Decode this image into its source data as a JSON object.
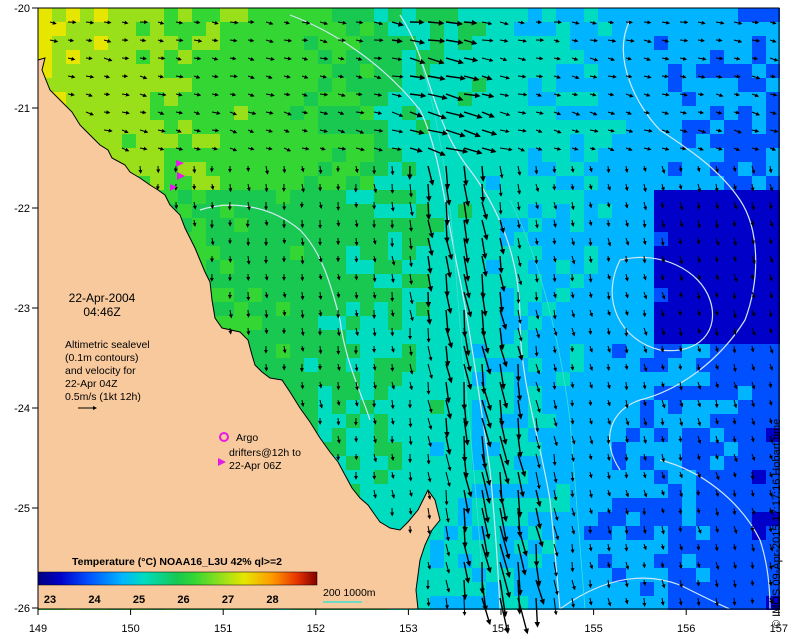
{
  "map": {
    "date": "22-Apr-2004",
    "time": "04:46Z",
    "altimetry_note": [
      "Altimetric sealevel",
      "(0.1m contours)",
      "and velocity for",
      "22-Apr 04Z",
      "0.5m/s (1kt 12h)"
    ],
    "argo_label": "Argo",
    "drifter_label": [
      "drifters@12h to",
      "22-Apr 06Z"
    ],
    "colorbar_title": "Temperature (°C) NOAA16_L3U 42% ql>=2",
    "colorbar_ticks": [
      "23",
      "24",
      "25",
      "26",
      "27",
      "28"
    ],
    "depth_legend": "200  1000m",
    "credit": "© IMOS 09-Apr-2015 17:17:16 Hobart time",
    "lat_labels": [
      "-20",
      "-21",
      "-22",
      "-23",
      "-24",
      "-25",
      "-26"
    ],
    "lon_labels": [
      "149",
      "150",
      "151",
      "152",
      "153",
      "154",
      "155",
      "156",
      "157"
    ],
    "colors": {
      "land": "#F7C99D",
      "sst_scale": [
        "#00007F",
        "#0000C8",
        "#0050FF",
        "#00B4FF",
        "#00DCC0",
        "#19C850",
        "#33D633",
        "#99E01A",
        "#E6E600",
        "#FF9900",
        "#E63300",
        "#800000"
      ],
      "argo": "#E61AE6",
      "drifter": "#E61AE6",
      "contour": "#CFE8F5",
      "depth_contour": "#40E0D0"
    }
  }
}
